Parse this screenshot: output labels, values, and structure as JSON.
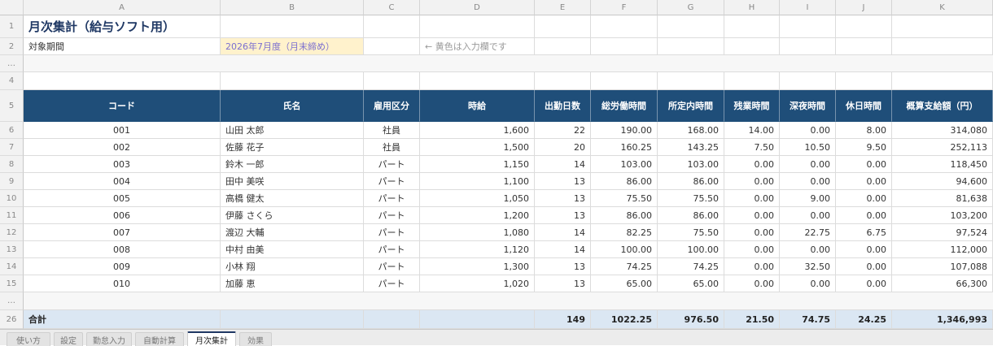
{
  "columns": [
    "A",
    "B",
    "C",
    "D",
    "E",
    "F",
    "G",
    "H",
    "I",
    "J",
    "K"
  ],
  "row_numbers": {
    "r1": "1",
    "r2": "2",
    "gap1": "…",
    "r4": "4",
    "r5": "5",
    "gap2": "…",
    "r26": "26"
  },
  "title": "月次集計（給与ソフト用）",
  "period_label": "対象期間",
  "period_value": "2026年7月度（月末締め）",
  "input_note": "← 黄色は入力欄です",
  "headers": [
    "コード",
    "氏名",
    "雇用区分",
    "時給",
    "出勤日数",
    "総労働時間",
    "所定内時間",
    "残業時間",
    "深夜時間",
    "休日時間",
    "概算支給額（円）"
  ],
  "rows": [
    {
      "rn": "6",
      "cells": [
        "001",
        "山田 太郎",
        "社員",
        "1,600",
        "22",
        "190.00",
        "168.00",
        "14.00",
        "0.00",
        "8.00",
        "314,080"
      ]
    },
    {
      "rn": "7",
      "cells": [
        "002",
        "佐藤 花子",
        "社員",
        "1,500",
        "20",
        "160.25",
        "143.25",
        "7.50",
        "10.50",
        "9.50",
        "252,113"
      ]
    },
    {
      "rn": "8",
      "cells": [
        "003",
        "鈴木 一郎",
        "パート",
        "1,150",
        "14",
        "103.00",
        "103.00",
        "0.00",
        "0.00",
        "0.00",
        "118,450"
      ]
    },
    {
      "rn": "9",
      "cells": [
        "004",
        "田中 美咲",
        "パート",
        "1,100",
        "13",
        "86.00",
        "86.00",
        "0.00",
        "0.00",
        "0.00",
        "94,600"
      ]
    },
    {
      "rn": "10",
      "cells": [
        "005",
        "高橋 健太",
        "パート",
        "1,050",
        "13",
        "75.50",
        "75.50",
        "0.00",
        "9.00",
        "0.00",
        "81,638"
      ]
    },
    {
      "rn": "11",
      "cells": [
        "006",
        "伊藤 さくら",
        "パート",
        "1,200",
        "13",
        "86.00",
        "86.00",
        "0.00",
        "0.00",
        "0.00",
        "103,200"
      ]
    },
    {
      "rn": "12",
      "cells": [
        "007",
        "渡辺 大輔",
        "パート",
        "1,080",
        "14",
        "82.25",
        "75.50",
        "0.00",
        "22.75",
        "6.75",
        "97,524"
      ]
    },
    {
      "rn": "13",
      "cells": [
        "008",
        "中村 由美",
        "パート",
        "1,120",
        "14",
        "100.00",
        "100.00",
        "0.00",
        "0.00",
        "0.00",
        "112,000"
      ]
    },
    {
      "rn": "14",
      "cells": [
        "009",
        "小林 翔",
        "パート",
        "1,300",
        "13",
        "74.25",
        "74.25",
        "0.00",
        "32.50",
        "0.00",
        "107,088"
      ]
    },
    {
      "rn": "15",
      "cells": [
        "010",
        "加藤 恵",
        "パート",
        "1,020",
        "13",
        "65.00",
        "65.00",
        "0.00",
        "0.00",
        "0.00",
        "66,300"
      ]
    }
  ],
  "total": {
    "label": "合計",
    "cells": [
      "",
      "",
      "",
      "149",
      "1022.25",
      "976.50",
      "21.50",
      "74.75",
      "24.25",
      "1,346,993"
    ]
  },
  "tabs": [
    {
      "label": "使い方",
      "active": false
    },
    {
      "label": "設定",
      "active": false
    },
    {
      "label": "勤怠入力",
      "active": false
    },
    {
      "label": "自動計算",
      "active": false
    },
    {
      "label": "月次集計",
      "active": true
    },
    {
      "label": "効果",
      "active": false
    }
  ],
  "colors": {
    "header_bg": "#1f4e79",
    "total_bg": "#dbe7f3",
    "input_bg": "#fff2cc",
    "title": "#1f3864"
  }
}
